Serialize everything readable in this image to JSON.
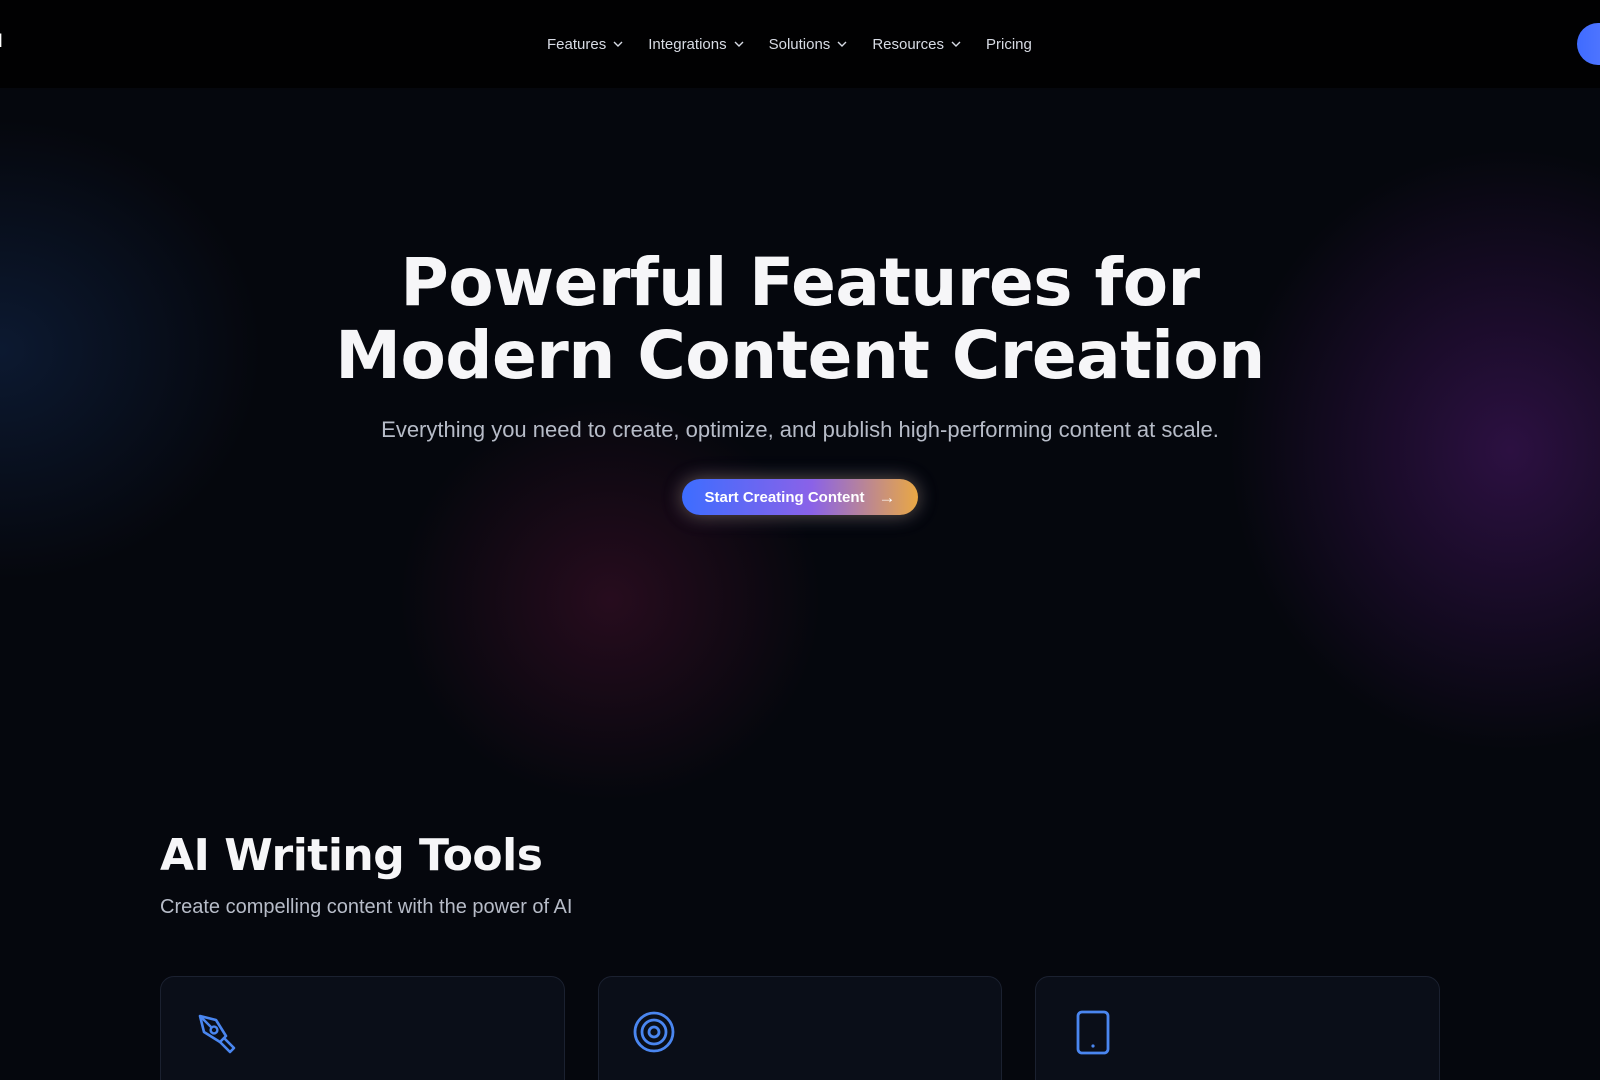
{
  "nav": {
    "logo_fragment": "I",
    "items": [
      {
        "label": "Features",
        "has_dropdown": true
      },
      {
        "label": "Integrations",
        "has_dropdown": true
      },
      {
        "label": "Solutions",
        "has_dropdown": true
      },
      {
        "label": "Resources",
        "has_dropdown": true
      },
      {
        "label": "Pricing",
        "has_dropdown": false
      }
    ]
  },
  "hero": {
    "title_line1": "Powerful Features for",
    "title_line2": "Modern Content Creation",
    "subtitle": "Everything you need to create, optimize, and publish high-performing content at scale.",
    "cta_label": "Start Creating Content",
    "cta_arrow": "→"
  },
  "section": {
    "title": "AI Writing Tools",
    "subtitle": "Create compelling content with the power of AI"
  },
  "cards": [
    {
      "icon": "pen-nib-icon"
    },
    {
      "icon": "target-icon"
    },
    {
      "icon": "tablet-icon"
    }
  ],
  "colors": {
    "background": "#05070d",
    "nav_bg": "#010102",
    "accent_blue": "#3d6dff",
    "accent_orange": "#e9a844",
    "icon_blue": "#4a86f0"
  }
}
